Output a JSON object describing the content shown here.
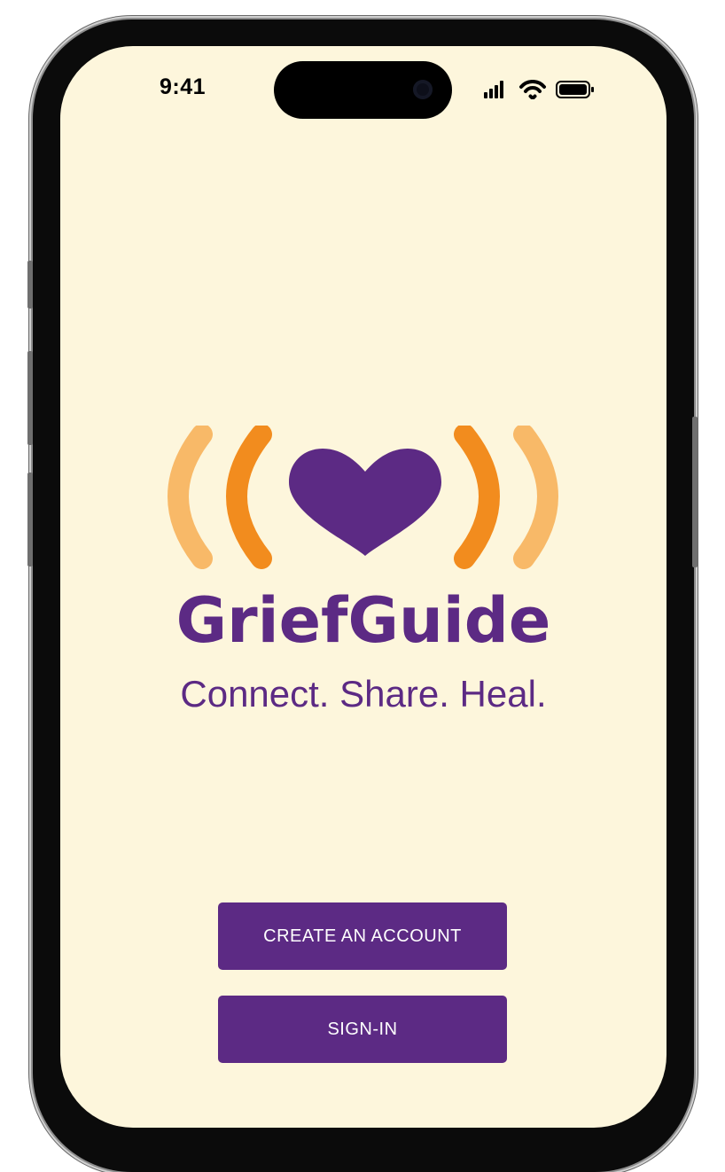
{
  "status_bar": {
    "time": "9:41"
  },
  "app": {
    "name": "GriefGuide",
    "tagline": "Connect. Share. Heal."
  },
  "buttons": {
    "create_account": "CREATE AN ACCOUNT",
    "sign_in": "SIGN-IN"
  },
  "colors": {
    "background": "#fdf6dc",
    "brand_purple": "#5c2a84",
    "orange": "#f28c1e",
    "light_orange": "#f8b968"
  },
  "icons": [
    "heart-icon",
    "signal-icon",
    "wifi-icon",
    "battery-icon"
  ]
}
